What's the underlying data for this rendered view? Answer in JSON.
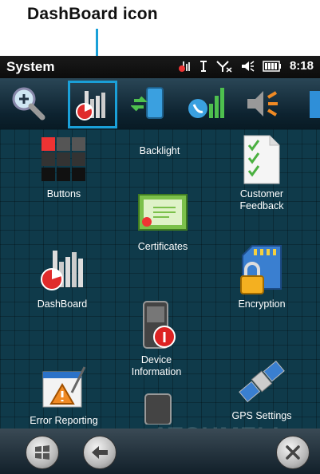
{
  "annotation": {
    "title": "DashBoard icon"
  },
  "statusbar": {
    "title": "System",
    "time": "8:18"
  },
  "iconbar": {
    "items": [
      {
        "name": "zoom-icon"
      },
      {
        "name": "dashboard-icon"
      },
      {
        "name": "phone-sync-icon"
      },
      {
        "name": "phone-signal-icon"
      },
      {
        "name": "speaker-icon"
      },
      {
        "name": "partial-icon"
      }
    ]
  },
  "apps": {
    "buttons": "Buttons",
    "backlight": "Backlight",
    "customer_feedback_1": "Customer",
    "customer_feedback_2": "Feedback",
    "certificates": "Certificates",
    "dashboard": "DashBoard",
    "encryption": "Encryption",
    "device_info_1": "Device",
    "device_info_2": "Information",
    "error_reporting": "Error Reporting",
    "gps_settings": "GPS Settings"
  },
  "watermark": "ATCHMELL",
  "colors": {
    "accent": "#1aa0d8",
    "background": "#0f3a4a"
  }
}
